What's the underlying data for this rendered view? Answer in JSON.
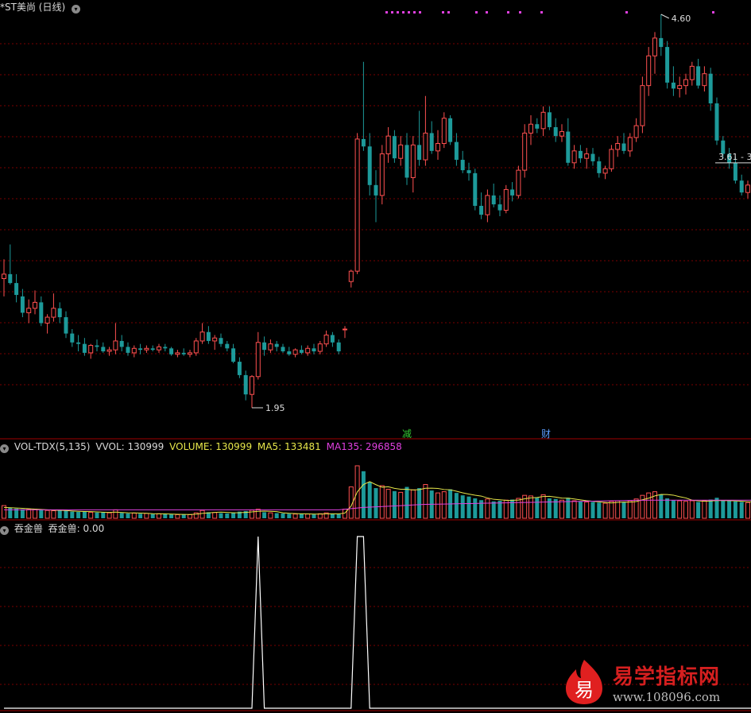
{
  "main_header": {
    "icon": "chevron-down-icon",
    "title": "*ST美尚 (日线)"
  },
  "vol_header": {
    "icon": "chevron-down-icon",
    "name": "VOL-TDX(5,135)",
    "vvol": "VVOL: 130999",
    "volume": "VOLUME: 130999",
    "ma5": "MA5: 133481",
    "ma135": "MA135: 296858"
  },
  "ind_header": {
    "icon": "chevron-down-icon",
    "name": "吞金兽",
    "value": "吞金兽: 0.00"
  },
  "markers": {
    "jian": "减",
    "cai": "财"
  },
  "watermark": {
    "icon_glyph": "易",
    "text": "易学指标网",
    "url": "www.108096.com"
  },
  "colors": {
    "up": "#ff5050",
    "down": "#1d9a9a",
    "grid": "#7a0000",
    "ma5": "#e6e64a",
    "ma135": "#e040e0",
    "signal_dots": "#e040e0",
    "indicator": "#ffffff"
  },
  "chart_data": [
    {
      "type": "candlestick",
      "title": "*ST美尚 (日线)",
      "annotations": {
        "high": "4.60",
        "low": "1.95",
        "last_price": "3.61 - 3"
      },
      "candles": [
        [
          2.82,
          2.95,
          2.7,
          2.85
        ],
        [
          2.85,
          3.05,
          2.78,
          2.79
        ],
        [
          2.79,
          2.85,
          2.66,
          2.71
        ],
        [
          2.7,
          2.75,
          2.56,
          2.59
        ],
        [
          2.59,
          2.68,
          2.52,
          2.62
        ],
        [
          2.62,
          2.74,
          2.58,
          2.66
        ],
        [
          2.66,
          2.7,
          2.5,
          2.52
        ],
        [
          2.52,
          2.58,
          2.45,
          2.56
        ],
        [
          2.56,
          2.72,
          2.53,
          2.62
        ],
        [
          2.62,
          2.66,
          2.52,
          2.56
        ],
        [
          2.56,
          2.6,
          2.42,
          2.45
        ],
        [
          2.45,
          2.48,
          2.36,
          2.39
        ],
        [
          2.39,
          2.44,
          2.33,
          2.38
        ],
        [
          2.38,
          2.42,
          2.3,
          2.32
        ],
        [
          2.32,
          2.38,
          2.28,
          2.37
        ],
        [
          2.37,
          2.41,
          2.33,
          2.36
        ],
        [
          2.36,
          2.39,
          2.32,
          2.33
        ],
        [
          2.33,
          2.36,
          2.3,
          2.34
        ],
        [
          2.34,
          2.52,
          2.31,
          2.4
        ],
        [
          2.4,
          2.44,
          2.33,
          2.36
        ],
        [
          2.36,
          2.39,
          2.3,
          2.32
        ],
        [
          2.32,
          2.37,
          2.29,
          2.35
        ],
        [
          2.35,
          2.38,
          2.31,
          2.34
        ],
        [
          2.34,
          2.37,
          2.32,
          2.35
        ],
        [
          2.35,
          2.37,
          2.33,
          2.34
        ],
        [
          2.34,
          2.38,
          2.32,
          2.36
        ],
        [
          2.36,
          2.38,
          2.33,
          2.35
        ],
        [
          2.35,
          2.36,
          2.3,
          2.31
        ],
        [
          2.31,
          2.34,
          2.29,
          2.32
        ],
        [
          2.32,
          2.35,
          2.3,
          2.31
        ],
        [
          2.31,
          2.34,
          2.29,
          2.32
        ],
        [
          2.32,
          2.42,
          2.3,
          2.4
        ],
        [
          2.4,
          2.52,
          2.38,
          2.46
        ],
        [
          2.46,
          2.5,
          2.38,
          2.4
        ],
        [
          2.4,
          2.44,
          2.34,
          2.42
        ],
        [
          2.42,
          2.45,
          2.36,
          2.38
        ],
        [
          2.38,
          2.4,
          2.33,
          2.35
        ],
        [
          2.35,
          2.38,
          2.25,
          2.26
        ],
        [
          2.26,
          2.29,
          2.15,
          2.17
        ],
        [
          2.17,
          2.2,
          2.0,
          2.04
        ],
        [
          2.04,
          2.17,
          1.95,
          2.16
        ],
        [
          2.16,
          2.46,
          2.14,
          2.39
        ],
        [
          2.39,
          2.43,
          2.3,
          2.34
        ],
        [
          2.34,
          2.41,
          2.32,
          2.38
        ],
        [
          2.38,
          2.4,
          2.33,
          2.36
        ],
        [
          2.36,
          2.38,
          2.32,
          2.33
        ],
        [
          2.33,
          2.36,
          2.3,
          2.31
        ],
        [
          2.31,
          2.35,
          2.29,
          2.34
        ],
        [
          2.34,
          2.37,
          2.31,
          2.32
        ],
        [
          2.32,
          2.37,
          2.3,
          2.35
        ],
        [
          2.35,
          2.38,
          2.31,
          2.33
        ],
        [
          2.33,
          2.4,
          2.31,
          2.38
        ],
        [
          2.38,
          2.47,
          2.36,
          2.44
        ],
        [
          2.44,
          2.46,
          2.36,
          2.39
        ],
        [
          2.39,
          2.41,
          2.31,
          2.33
        ],
        [
          2.48,
          2.5,
          2.42,
          2.48
        ],
        [
          2.8,
          2.88,
          2.76,
          2.87
        ],
        [
          2.87,
          3.8,
          2.85,
          3.76
        ],
        [
          3.76,
          4.28,
          3.68,
          3.71
        ],
        [
          3.71,
          3.8,
          3.38,
          3.45
        ],
        [
          3.45,
          3.55,
          3.2,
          3.38
        ],
        [
          3.38,
          3.72,
          3.32,
          3.66
        ],
        [
          3.66,
          3.84,
          3.6,
          3.78
        ],
        [
          3.78,
          3.82,
          3.6,
          3.63
        ],
        [
          3.63,
          3.78,
          3.58,
          3.72
        ],
        [
          3.72,
          3.8,
          3.45,
          3.5
        ],
        [
          3.5,
          3.78,
          3.4,
          3.72
        ],
        [
          3.72,
          3.95,
          3.58,
          3.62
        ],
        [
          3.62,
          4.05,
          3.58,
          3.8
        ],
        [
          3.8,
          3.88,
          3.66,
          3.68
        ],
        [
          3.68,
          3.82,
          3.62,
          3.73
        ],
        [
          3.73,
          3.94,
          3.7,
          3.9
        ],
        [
          3.9,
          3.92,
          3.72,
          3.74
        ],
        [
          3.74,
          3.8,
          3.58,
          3.62
        ],
        [
          3.62,
          3.68,
          3.53,
          3.55
        ],
        [
          3.55,
          3.6,
          3.48,
          3.53
        ],
        [
          3.53,
          3.56,
          3.28,
          3.31
        ],
        [
          3.31,
          3.4,
          3.22,
          3.25
        ],
        [
          3.25,
          3.42,
          3.2,
          3.38
        ],
        [
          3.38,
          3.46,
          3.3,
          3.32
        ],
        [
          3.32,
          3.38,
          3.24,
          3.28
        ],
        [
          3.28,
          3.45,
          3.26,
          3.42
        ],
        [
          3.42,
          3.47,
          3.34,
          3.38
        ],
        [
          3.38,
          3.58,
          3.36,
          3.55
        ],
        [
          3.55,
          3.86,
          3.5,
          3.8
        ],
        [
          3.8,
          3.92,
          3.72,
          3.86
        ],
        [
          3.86,
          3.9,
          3.8,
          3.83
        ],
        [
          3.83,
          3.98,
          3.78,
          3.94
        ],
        [
          3.94,
          3.98,
          3.82,
          3.84
        ],
        [
          3.84,
          3.9,
          3.74,
          3.78
        ],
        [
          3.78,
          3.86,
          3.74,
          3.81
        ],
        [
          3.81,
          3.9,
          3.58,
          3.6
        ],
        [
          3.6,
          3.72,
          3.56,
          3.68
        ],
        [
          3.68,
          3.72,
          3.6,
          3.63
        ],
        [
          3.63,
          3.7,
          3.56,
          3.66
        ],
        [
          3.66,
          3.7,
          3.58,
          3.61
        ],
        [
          3.61,
          3.64,
          3.5,
          3.53
        ],
        [
          3.53,
          3.58,
          3.49,
          3.56
        ],
        [
          3.56,
          3.72,
          3.54,
          3.69
        ],
        [
          3.69,
          3.78,
          3.64,
          3.73
        ],
        [
          3.73,
          3.8,
          3.66,
          3.68
        ],
        [
          3.68,
          3.8,
          3.64,
          3.77
        ],
        [
          3.77,
          3.9,
          3.74,
          3.85
        ],
        [
          3.85,
          4.18,
          3.8,
          4.12
        ],
        [
          4.12,
          4.38,
          4.05,
          4.32
        ],
        [
          4.32,
          4.48,
          4.2,
          4.44
        ],
        [
          4.44,
          4.6,
          4.32,
          4.38
        ],
        [
          4.38,
          4.42,
          4.1,
          4.14
        ],
        [
          4.14,
          4.25,
          4.05,
          4.1
        ],
        [
          4.1,
          4.18,
          4.04,
          4.12
        ],
        [
          4.12,
          4.2,
          4.06,
          4.16
        ],
        [
          4.16,
          4.28,
          4.12,
          4.25
        ],
        [
          4.25,
          4.3,
          4.1,
          4.12
        ],
        [
          4.12,
          4.25,
          4.08,
          4.2
        ],
        [
          4.2,
          4.24,
          3.95,
          4.0
        ],
        [
          4.0,
          4.04,
          3.72,
          3.75
        ],
        [
          3.75,
          3.78,
          3.63,
          3.66
        ],
        [
          3.66,
          3.7,
          3.56,
          3.6
        ],
        [
          3.6,
          3.64,
          3.46,
          3.48
        ],
        [
          3.48,
          3.52,
          3.38,
          3.4
        ],
        [
          3.4,
          3.48,
          3.36,
          3.45
        ],
        [
          3.45,
          3.5,
          3.38,
          3.41
        ]
      ]
    },
    {
      "type": "bar",
      "title": "VOL-TDX(5,135)",
      "series": [
        {
          "name": "VOLUME",
          "values": [
            210,
            175,
            160,
            150,
            145,
            150,
            140,
            130,
            125,
            140,
            130,
            110,
            105,
            115,
            100,
            95,
            100,
            90,
            140,
            90,
            80,
            85,
            75,
            80,
            70,
            75,
            70,
            65,
            60,
            65,
            60,
            90,
            130,
            100,
            95,
            85,
            80,
            95,
            110,
            120,
            135,
            150,
            100,
            90,
            85,
            80,
            75,
            70,
            75,
            70,
            65,
            75,
            90,
            80,
            70,
            150,
            520,
            870,
            780,
            600,
            500,
            540,
            480,
            450,
            430,
            520,
            470,
            500,
            560,
            460,
            420,
            440,
            480,
            420,
            380,
            360,
            330,
            300,
            320,
            280,
            290,
            300,
            310,
            330,
            380,
            370,
            340,
            390,
            330,
            320,
            300,
            340,
            290,
            280,
            270,
            270,
            260,
            250,
            280,
            290,
            270,
            290,
            320,
            380,
            420,
            440,
            390,
            330,
            300,
            290,
            280,
            290,
            270,
            290,
            310,
            340,
            300,
            290,
            280,
            270,
            260,
            280
          ]
        },
        {
          "name": "MA5",
          "values": [
            180,
            175,
            170,
            165,
            158,
            152,
            147,
            140,
            133,
            132,
            128,
            121,
            116,
            112,
            110,
            105,
            101,
            97,
            102,
            95,
            90,
            89,
            85,
            82,
            76,
            73,
            72,
            69,
            66,
            64,
            62,
            68,
            80,
            89,
            98,
            102,
            98,
            91,
            92,
            98,
            106,
            116,
            118,
            115,
            110,
            91,
            82,
            78,
            74,
            72,
            69,
            70,
            73,
            73,
            73,
            86,
            201,
            438,
            560,
            608,
            557,
            515,
            522,
            496,
            481,
            480,
            469,
            474,
            497,
            499,
            495,
            477,
            472,
            448,
            422,
            401,
            382,
            368,
            337,
            314,
            306,
            297,
            298,
            302,
            323,
            337,
            344,
            361,
            364,
            351,
            335,
            333,
            319,
            305,
            292,
            282,
            272,
            262,
            254,
            264,
            269,
            267,
            277,
            306,
            333,
            371,
            396,
            393,
            383,
            357,
            337,
            300,
            288,
            282,
            286,
            293,
            294,
            291,
            288,
            282,
            276,
            270
          ]
        },
        {
          "name": "MA135",
          "values": [
            140,
            140,
            140,
            140,
            140,
            140,
            140,
            140,
            140,
            140,
            140,
            140,
            140,
            140,
            140,
            140,
            140,
            140,
            140,
            140,
            140,
            140,
            140,
            140,
            140,
            140,
            140,
            140,
            140,
            140,
            140,
            140,
            140,
            140,
            140,
            140,
            140,
            140,
            140,
            140,
            140,
            140,
            140,
            140,
            140,
            140,
            140,
            140,
            140,
            140,
            140,
            140,
            140,
            140,
            140,
            150,
            160,
            170,
            180,
            185,
            190,
            195,
            200,
            205,
            210,
            215,
            220,
            225,
            230,
            232,
            234,
            236,
            238,
            240,
            242,
            244,
            246,
            248,
            250,
            252,
            254,
            256,
            258,
            260,
            262,
            264,
            266,
            268,
            270,
            272,
            274,
            276,
            278,
            280,
            282,
            284,
            286,
            288,
            290,
            292,
            294,
            296,
            298,
            299,
            300,
            300,
            300,
            300,
            300,
            300,
            300,
            300,
            300,
            300,
            300,
            300,
            300,
            300,
            300,
            300,
            300,
            300
          ]
        }
      ]
    },
    {
      "type": "line",
      "title": "吞金兽",
      "series": [
        {
          "name": "吞金兽",
          "values": [
            0,
            0,
            0,
            0,
            0,
            0,
            0,
            0,
            0,
            0,
            0,
            0,
            0,
            0,
            0,
            0,
            0,
            0,
            0,
            0,
            0,
            0,
            0,
            0,
            0,
            0,
            0,
            0,
            0,
            0,
            0,
            0,
            0,
            0,
            0,
            0,
            0,
            0,
            0,
            0,
            0,
            1,
            0,
            0,
            0,
            0,
            0,
            0,
            0,
            0,
            0,
            0,
            0,
            0,
            0,
            0,
            0,
            1,
            1,
            0,
            0,
            0,
            0,
            0,
            0,
            0,
            0,
            0,
            0,
            0,
            0,
            0,
            0,
            0,
            0,
            0,
            0,
            0,
            0,
            0,
            0,
            0,
            0,
            0,
            0,
            0,
            0,
            0,
            0,
            0,
            0,
            0,
            0,
            0,
            0,
            0,
            0,
            0,
            0,
            0,
            0,
            0,
            0,
            0,
            0,
            0,
            0,
            0,
            0,
            0,
            0,
            0,
            0,
            0,
            0,
            0,
            0,
            0,
            0,
            0,
            0,
            0
          ]
        }
      ]
    }
  ]
}
